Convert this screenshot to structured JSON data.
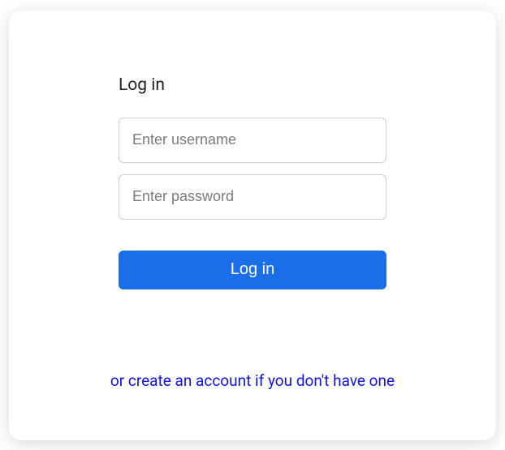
{
  "login": {
    "heading": "Log in",
    "username_placeholder": "Enter username",
    "username_value": "",
    "password_placeholder": "Enter password",
    "password_value": "",
    "submit_label": "Log in"
  },
  "footer": {
    "create_account_text": "or create an account if you don't have one"
  }
}
